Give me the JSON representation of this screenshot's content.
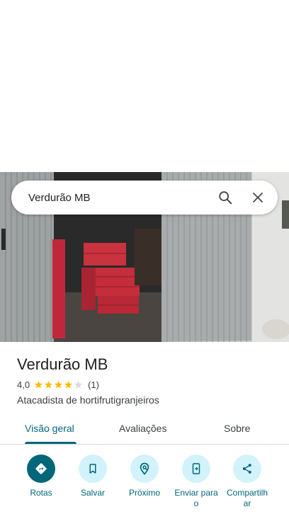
{
  "search": {
    "query": "Verdurão MB"
  },
  "place": {
    "title": "Verdurão MB",
    "rating": "4,0",
    "stars_filled": 4,
    "stars_total": 5,
    "review_count": "(1)",
    "category": "Atacadista de hortifrutigranjeiros"
  },
  "tabs": [
    {
      "label": "Visão geral",
      "active": true
    },
    {
      "label": "Avaliações",
      "active": false
    },
    {
      "label": "Sobre",
      "active": false
    }
  ],
  "actions": [
    {
      "label": "Rotas",
      "icon": "directions-icon"
    },
    {
      "label": "Salvar",
      "icon": "bookmark-icon"
    },
    {
      "label": "Próximo",
      "icon": "nearby-icon"
    },
    {
      "label": "Enviar para o",
      "icon": "send-to-phone-icon"
    },
    {
      "label": "Compartilhar",
      "icon": "share-icon"
    }
  ],
  "colors": {
    "accent": "#00677b",
    "accent_light": "#d2f3fb",
    "star": "#fbbc04"
  }
}
